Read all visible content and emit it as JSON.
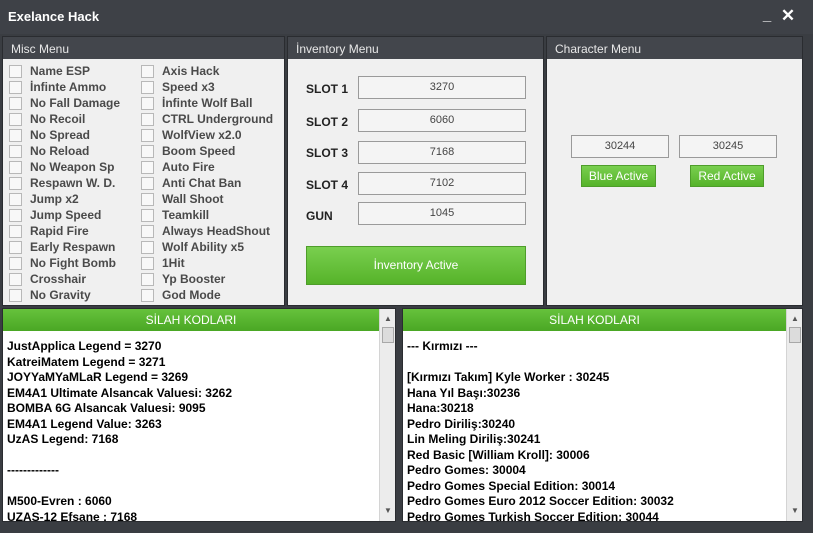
{
  "window": {
    "title": "Exelance Hack",
    "minimize": "_",
    "close": "✕"
  },
  "misc": {
    "header": "Misc Menu",
    "col1": [
      "Name ESP",
      "İnfinte Ammo",
      "No Fall Damage",
      "No Recoil",
      "No Spread",
      "No Reload",
      "No Weapon Sp",
      "Respawn W. D.",
      "Jump x2",
      "Jump Speed",
      "Rapid Fire",
      "Early Respawn",
      "No Fight Bomb",
      "Crosshair",
      "No Gravity"
    ],
    "col2": [
      "Axis Hack",
      "Speed x3",
      "İnfinte Wolf Ball",
      "CTRL Underground",
      "WolfView x2.0",
      "Boom Speed",
      "Auto Fire",
      "Anti Chat Ban",
      "Wall Shoot",
      "Teamkill",
      "Always HeadShout",
      "Wolf Ability x5",
      "1Hit",
      "Yp Booster",
      "God Mode"
    ]
  },
  "inventory": {
    "header": "İnventory Menu",
    "slots": [
      {
        "label": "SLOT 1",
        "value": "3270"
      },
      {
        "label": "SLOT 2",
        "value": "6060"
      },
      {
        "label": "SLOT 3",
        "value": "7168"
      },
      {
        "label": "SLOT 4",
        "value": "7102"
      },
      {
        "label": "GUN",
        "value": "1045"
      }
    ],
    "button": "İnventory Active"
  },
  "character": {
    "header": "Character Menu",
    "blue_value": "30244",
    "red_value": "30245",
    "blue_button": "Blue Active",
    "red_button": "Red Active"
  },
  "codes_left": {
    "header": "SİLAH KODLARI",
    "lines": [
      "JustApplica Legend = 3270",
      "KatreiMatem Legend = 3271",
      "JOYYaMYaMLaR Legend = 3269",
      "EM4A1 Ultimate Alsancak Valuesi: 3262",
      "BOMBA 6G Alsancak Valuesi: 9095",
      "EM4A1 Legend Value: 3263",
      "UzAS Legend: 7168",
      "",
      "-------------",
      "",
      "M500-Evren : 6060",
      "UZAS-12 Efsane : 7168"
    ]
  },
  "codes_right": {
    "header": "SİLAH KODLARI",
    "lines": [
      "--- Kırmızı ---",
      "",
      "[Kırmızı Takım] Kyle Worker : 30245",
      "Hana Yıl Başı:30236",
      "Hana:30218",
      "Pedro Diriliş:30240",
      "Lin Meling Diriliş:30241",
      "Red Basic [William Kroll]: 30006",
      "Pedro Gomes: 30004",
      "Pedro Gomes Special Edition: 30014",
      "Pedro Gomes Euro 2012 Soccer Edition: 30032",
      "Pedro Gomes Turkish Soccer Edition: 30044"
    ]
  },
  "icons": {
    "scroll_up": "▲",
    "scroll_down": "▼"
  },
  "colors": {
    "accent_green": "#5cb830",
    "panel_header": "#43464c",
    "background": "#3a3d42"
  }
}
